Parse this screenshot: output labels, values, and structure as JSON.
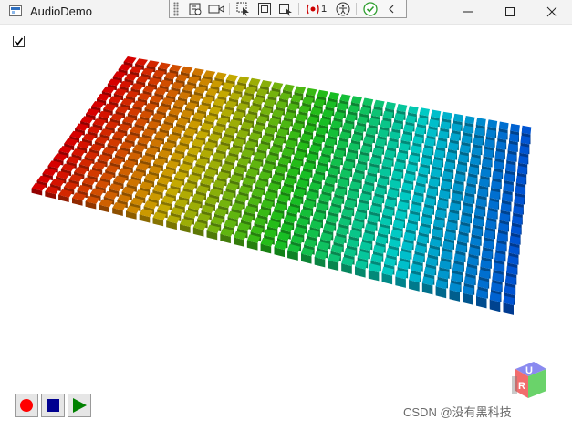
{
  "window": {
    "title": "AudioDemo",
    "minimize_icon": "minimize-icon",
    "maximize_icon": "maximize-icon",
    "close_icon": "close-icon"
  },
  "debug_toolbar": {
    "icons": [
      "live-visual-tree-icon",
      "record-icon",
      "select-element-icon",
      "display-layout-adorners-icon",
      "track-focused-element-icon",
      "binding-failures-icon",
      "accessibility-icon",
      "checkmark-icon",
      "collapse-toolbar-icon"
    ],
    "binding_failures_count": "1"
  },
  "checkbox": {
    "checked": true
  },
  "bar_grid": {
    "rows": 18,
    "columns": 36,
    "colormap": [
      "#cc0000",
      "#c0a000",
      "#18b418",
      "#00c0c0",
      "#0050c8"
    ]
  },
  "controls": [
    {
      "icon": "record-icon",
      "color": "#ff0000"
    },
    {
      "icon": "stop-icon",
      "color": "#000090"
    },
    {
      "icon": "play-icon",
      "color": "#008000"
    }
  ],
  "viewcube": {
    "labels": [
      "U",
      "R"
    ],
    "icon": "view-cube-icon"
  },
  "watermark": "CSDN @没有黑科技"
}
